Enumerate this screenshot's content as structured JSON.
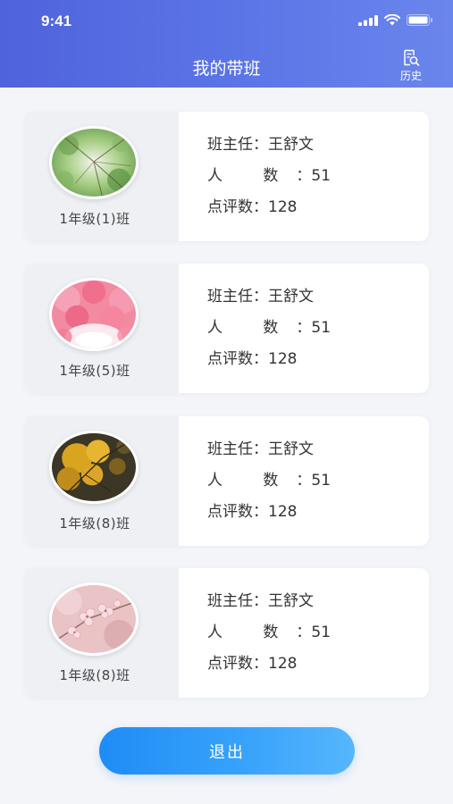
{
  "status_bar": {
    "time": "9:41"
  },
  "header": {
    "title": "我的带班",
    "history_label": "历史"
  },
  "labels": {
    "teacher": "班主任：",
    "count": "人  数：",
    "reviews": "点评数："
  },
  "classes": [
    {
      "name": "1年级(1)班",
      "teacher": "王舒文",
      "count": "51",
      "reviews": "128",
      "photo": "green-leaves-photo"
    },
    {
      "name": "1年级(5)班",
      "teacher": "王舒文",
      "count": "51",
      "reviews": "128",
      "photo": "pink-blossom-photo"
    },
    {
      "name": "1年级(8)班",
      "teacher": "王舒文",
      "count": "51",
      "reviews": "128",
      "photo": "autumn-leaves-photo"
    },
    {
      "name": "1年级(8)班",
      "teacher": "王舒文",
      "count": "51",
      "reviews": "128",
      "photo": "cherry-blossom-photo"
    }
  ],
  "footer": {
    "logout_label": "退出"
  },
  "colors": {
    "header": "#5a6fe3",
    "button": "#2f9af8",
    "background": "#f3f5f9"
  }
}
